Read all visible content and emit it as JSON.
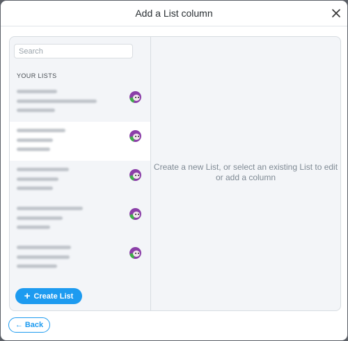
{
  "dialog": {
    "title": "Add a List column",
    "close_icon": "close-icon"
  },
  "sidebar": {
    "search_placeholder": "Search",
    "section_label": "YOUR LISTS",
    "create_button_label": "Create List",
    "create_icon": "plus-icon",
    "lists": [
      {
        "selected": false,
        "avatar_icon": "avatar-icon"
      },
      {
        "selected": true,
        "avatar_icon": "avatar-icon"
      },
      {
        "selected": false,
        "avatar_icon": "avatar-icon"
      },
      {
        "selected": false,
        "avatar_icon": "avatar-icon"
      },
      {
        "selected": false,
        "avatar_icon": "avatar-icon"
      }
    ]
  },
  "main": {
    "empty_message": "Create a new List, or select an existing List to edit or add a column"
  },
  "footer": {
    "back_label": "Back",
    "back_icon": "arrow-left-icon"
  },
  "colors": {
    "accent": "#1d9bf0",
    "panel_bg": "#f3f5f8",
    "avatar_purple": "#8b3fa8"
  }
}
